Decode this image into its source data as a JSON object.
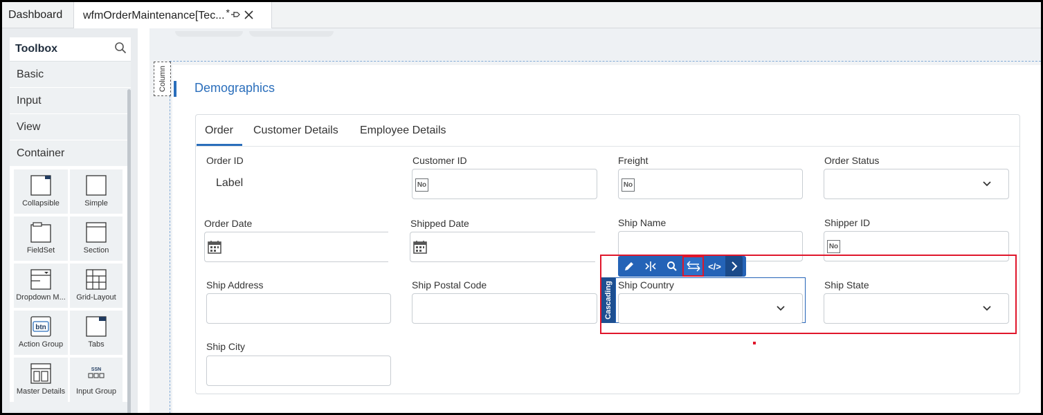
{
  "tabs": {
    "dashboard": "Dashboard",
    "active": "wfmOrderMaintenance[Tec...",
    "modified": "*"
  },
  "toolbox": {
    "title": "Toolbox",
    "categories": [
      "Basic",
      "Input",
      "View",
      "Container"
    ],
    "items": [
      {
        "label": "Collapsible",
        "icon": "collapsible-icon"
      },
      {
        "label": "Simple",
        "icon": "simple-icon"
      },
      {
        "label": "FieldSet",
        "icon": "fieldset-icon"
      },
      {
        "label": "Section",
        "icon": "section-icon"
      },
      {
        "label": "Dropdown M...",
        "icon": "dropdown-menu-icon"
      },
      {
        "label": "Grid-Layout",
        "icon": "grid-layout-icon"
      },
      {
        "label": "Action Group",
        "icon": "action-group-icon"
      },
      {
        "label": "Tabs",
        "icon": "tabs-icon"
      },
      {
        "label": "Master Details",
        "icon": "master-details-icon"
      },
      {
        "label": "Input Group",
        "icon": "input-group-icon"
      }
    ],
    "btn_icon_text": "btn",
    "ssn_icon_text": "SSN"
  },
  "designer": {
    "column_tag": "Column",
    "section_title": "Demographics",
    "form_tabs": [
      "Order",
      "Customer Details",
      "Employee Details"
    ],
    "fields": {
      "order_id": "Order ID",
      "order_id_value": "Label",
      "customer_id": "Customer ID",
      "freight": "Freight",
      "order_status": "Order Status",
      "order_date": "Order Date",
      "shipped_date": "Shipped Date",
      "ship_name": "Ship Name",
      "shipper_id": "Shipper ID",
      "ship_address": "Ship Address",
      "ship_postal_code": "Ship Postal Code",
      "ship_country": "Ship Country",
      "ship_state": "Ship State",
      "ship_city": "Ship City"
    },
    "no_icon_text": "No",
    "cascading_tag": "Cascading",
    "context_toolbar": {
      "edit": "edit-icon",
      "split": "split-icon",
      "search": "search-icon",
      "swap": "swap-arrows-icon",
      "code": "</>",
      "more": "chevron-right-icon"
    }
  },
  "colors": {
    "accent": "#2a6ebb",
    "highlight": "#e0162b",
    "toolbar": "#2463b7"
  }
}
